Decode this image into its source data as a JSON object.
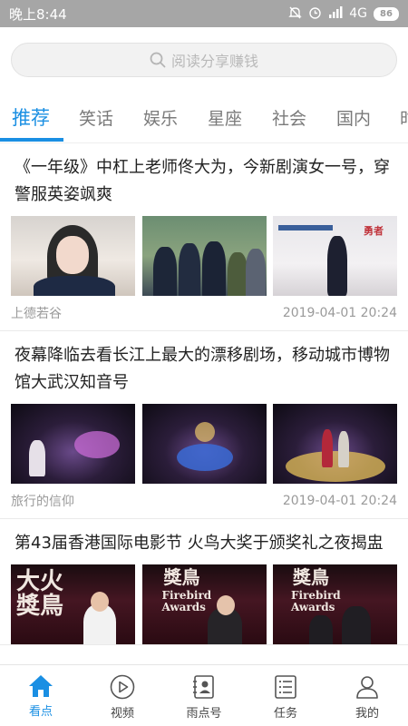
{
  "status_bar": {
    "time": "晚上8:44",
    "network": "4G",
    "battery": "86"
  },
  "search": {
    "placeholder": "阅读分享赚钱"
  },
  "tabs": [
    "推荐",
    "笑话",
    "娱乐",
    "星座",
    "社会",
    "国内",
    "时"
  ],
  "active_tab": 0,
  "articles": [
    {
      "title": "《一年级》中杠上老师佟大为，今新剧演女一号，穿警服英姿飒爽",
      "source": "上德若谷",
      "time": "2019-04-01 20:24"
    },
    {
      "title": "夜幕降临去看长江上最大的漂移剧场，移动城市博物馆大武汉知音号",
      "source": "旅行的信仰",
      "time": "2019-04-01 20:24"
    },
    {
      "title": "第43届香港国际电影节 火鸟大奖于颁奖礼之夜揭盅",
      "source": "",
      "time": ""
    }
  ],
  "bottom_nav": [
    {
      "label": "看点",
      "icon": "home-icon"
    },
    {
      "label": "视频",
      "icon": "play-circle-icon"
    },
    {
      "label": "雨点号",
      "icon": "contact-book-icon"
    },
    {
      "label": "任务",
      "icon": "task-list-icon"
    },
    {
      "label": "我的",
      "icon": "profile-icon"
    }
  ],
  "colors": {
    "accent": "#1a8fe3",
    "status_bar": "#a6a6a6"
  }
}
